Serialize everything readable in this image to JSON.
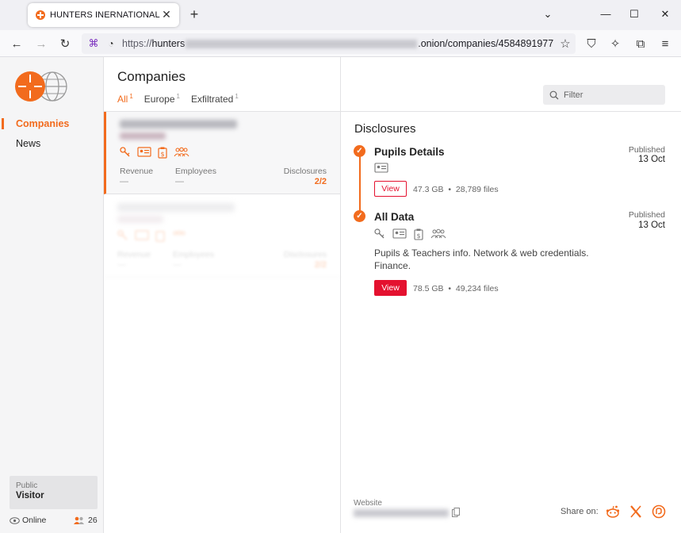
{
  "browser": {
    "tab_title": "HUNTERS INERNATIONAL",
    "url_prefix": "https://",
    "url_host": "hunters",
    "url_suffix": ".onion/companies/4584891977"
  },
  "sidebar": {
    "items": [
      {
        "label": "Companies",
        "active": true
      },
      {
        "label": "News",
        "active": false
      }
    ],
    "visitor_label": "Public",
    "visitor_name": "Visitor",
    "online_label": "Online",
    "user_count": "26"
  },
  "main": {
    "heading": "Companies",
    "tabs": [
      {
        "label": "All",
        "count": "1",
        "active": true
      },
      {
        "label": "Europe",
        "count": "1",
        "active": false
      },
      {
        "label": "Exfiltrated",
        "count": "1",
        "active": false
      }
    ],
    "filter_placeholder": "Filter"
  },
  "companies": [
    {
      "revenue_label": "Revenue",
      "revenue": "—",
      "employees_label": "Employees",
      "employees": "—",
      "disclosures_label": "Disclosures",
      "disclosures": "2/2"
    },
    {
      "revenue_label": "Revenue",
      "revenue": "—",
      "employees_label": "Employees",
      "employees": "—",
      "disclosures_label": "Disclosures",
      "disclosures": "2/2"
    }
  ],
  "detail": {
    "title": "Disclosures",
    "disclosures": [
      {
        "title": "Pupils Details",
        "published_label": "Published",
        "published_date": "13 Oct",
        "view_label": "View",
        "size": "47.3 GB",
        "files": "28,789 files"
      },
      {
        "title": "All Data",
        "published_label": "Published",
        "published_date": "13 Oct",
        "description": "Pupils & Teachers info. Network & web credentials. Finance.",
        "view_label": "View",
        "size": "78.5 GB",
        "files": "49,234 files"
      }
    ],
    "website_label": "Website",
    "share_label": "Share on:"
  },
  "colors": {
    "accent": "#f26b1d",
    "danger": "#e4112f"
  }
}
